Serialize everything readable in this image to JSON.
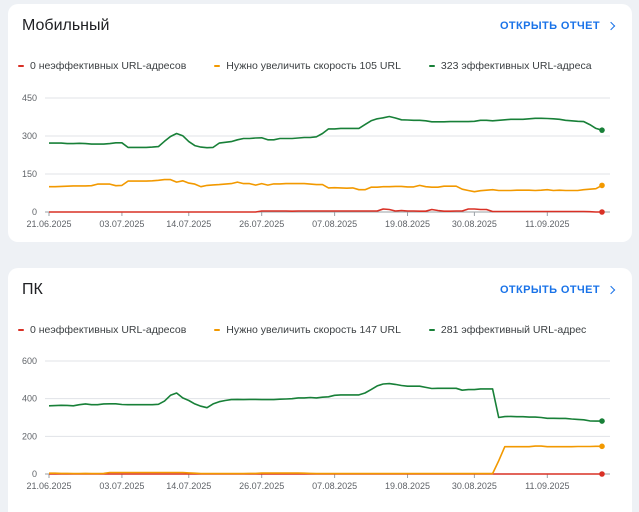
{
  "colors": {
    "error": "#d93025",
    "warning": "#f29900",
    "good": "#188038",
    "accent": "#1a73e8"
  },
  "chart_data": [
    {
      "type": "line",
      "title": "Мобильный",
      "action": "ОТКРЫТЬ ОТЧЕТ",
      "ylim": [
        0,
        450
      ],
      "yticks": [
        "0",
        "150",
        "300",
        "450"
      ],
      "xtick_labels": [
        "21.06.2025",
        "03.07.2025",
        "14.07.2025",
        "26.07.2025",
        "07.08.2025",
        "19.08.2025",
        "30.08.2025",
        "11.09.2025"
      ],
      "xtick_index": [
        0,
        12,
        23,
        35,
        47,
        59,
        70,
        82
      ],
      "legend": [
        "0 неэффективных URL-адресов",
        "Нужно увеличить скорость 105 URL",
        "323 эффективных URL-адреса"
      ],
      "series": [
        {
          "name": "0 неэффективных URL-адресов",
          "color": "#d93025",
          "values": [
            0,
            0,
            0,
            0,
            0,
            0,
            0,
            0,
            0,
            0,
            0,
            0,
            0,
            0,
            0,
            0,
            0,
            0,
            0,
            0,
            0,
            0,
            0,
            0,
            0,
            0,
            0,
            0,
            0,
            0,
            0,
            0,
            0,
            0,
            0,
            4,
            4,
            4,
            4,
            4,
            3,
            4,
            4,
            4,
            4,
            4,
            4,
            4,
            4,
            4,
            4,
            4,
            4,
            4,
            4,
            12,
            10,
            4,
            6,
            4,
            4,
            3,
            3,
            10,
            6,
            3,
            3,
            4,
            4,
            12,
            12,
            10,
            10,
            2,
            2,
            2,
            2,
            2,
            2,
            2,
            2,
            2,
            2,
            2,
            2,
            2,
            2,
            2,
            2,
            1,
            0,
            0
          ]
        },
        {
          "name": "Нужно увеличить скорость 105 URL",
          "color": "#f29900",
          "values": [
            100,
            100,
            101,
            102,
            103,
            103,
            103,
            104,
            110,
            110,
            110,
            104,
            105,
            122,
            122,
            122,
            122,
            123,
            125,
            128,
            128,
            118,
            123,
            114,
            110,
            100,
            105,
            107,
            108,
            110,
            112,
            118,
            112,
            112,
            106,
            112,
            106,
            111,
            111,
            112,
            112,
            112,
            112,
            110,
            108,
            108,
            95,
            96,
            95,
            94,
            95,
            88,
            88,
            98,
            98,
            100,
            100,
            101,
            101,
            99,
            99,
            105,
            100,
            98,
            98,
            102,
            102,
            102,
            90,
            85,
            80,
            84,
            86,
            88,
            85,
            85,
            85,
            86,
            86,
            86,
            85,
            86,
            88,
            85,
            86,
            85,
            85,
            85,
            88,
            90,
            92,
            105
          ]
        },
        {
          "name": "323 эффективных URL-адреса",
          "color": "#188038",
          "values": [
            272,
            272,
            272,
            270,
            270,
            271,
            270,
            268,
            268,
            268,
            270,
            273,
            273,
            255,
            255,
            255,
            255,
            256,
            258,
            279,
            298,
            310,
            301,
            278,
            262,
            256,
            254,
            255,
            272,
            275,
            278,
            285,
            290,
            290,
            292,
            293,
            285,
            285,
            290,
            290,
            290,
            292,
            294,
            294,
            297,
            310,
            328,
            328,
            330,
            330,
            330,
            330,
            345,
            360,
            368,
            372,
            377,
            371,
            364,
            363,
            362,
            362,
            360,
            356,
            356,
            356,
            357,
            357,
            357,
            357,
            358,
            362,
            362,
            360,
            362,
            364,
            366,
            366,
            366,
            368,
            370,
            370,
            369,
            368,
            366,
            362,
            360,
            358,
            357,
            345,
            330,
            323
          ]
        }
      ]
    },
    {
      "type": "line",
      "title": "ПК",
      "action": "ОТКРЫТЬ ОТЧЕТ",
      "ylim": [
        0,
        600
      ],
      "yticks": [
        "0",
        "200",
        "400",
        "600"
      ],
      "xtick_labels": [
        "21.06.2025",
        "03.07.2025",
        "14.07.2025",
        "26.07.2025",
        "07.08.2025",
        "19.08.2025",
        "30.08.2025",
        "11.09.2025"
      ],
      "xtick_index": [
        0,
        12,
        23,
        35,
        47,
        59,
        70,
        82
      ],
      "legend": [
        "0 неэффективных URL-адресов",
        "Нужно увеличить скорость 147 URL",
        "281 эффективный URL-адрес"
      ],
      "series": [
        {
          "name": "0 неэффективных URL-адресов",
          "color": "#d93025",
          "values": [
            0,
            0,
            0,
            0,
            0,
            0,
            0,
            0,
            0,
            0,
            0,
            0,
            0,
            0,
            0,
            0,
            0,
            0,
            0,
            0,
            0,
            0,
            0,
            0,
            0,
            0,
            0,
            0,
            0,
            0,
            0,
            0,
            0,
            0,
            0,
            0,
            0,
            0,
            0,
            0,
            0,
            0,
            0,
            0,
            0,
            0,
            0,
            0,
            0,
            0,
            0,
            0,
            0,
            0,
            0,
            0,
            0,
            0,
            0,
            0,
            0,
            0,
            0,
            0,
            0,
            0,
            0,
            0,
            0,
            0,
            0,
            0,
            0,
            0,
            0,
            0,
            0,
            0,
            0,
            0,
            0,
            0,
            0,
            0,
            0,
            0,
            0,
            0,
            0,
            0,
            0,
            0
          ]
        },
        {
          "name": "Нужно увеличить скорость 147 URL",
          "color": "#f29900",
          "values": [
            4,
            4,
            3,
            3,
            2,
            2,
            3,
            2,
            2,
            3,
            8,
            8,
            8,
            8,
            8,
            8,
            8,
            8,
            8,
            8,
            8,
            8,
            8,
            6,
            4,
            2,
            2,
            2,
            2,
            2,
            2,
            2,
            2,
            3,
            3,
            5,
            5,
            5,
            5,
            5,
            5,
            5,
            4,
            3,
            2,
            2,
            2,
            2,
            2,
            2,
            2,
            2,
            2,
            2,
            2,
            2,
            2,
            2,
            2,
            2,
            2,
            2,
            2,
            2,
            2,
            2,
            2,
            2,
            2,
            2,
            2,
            2,
            2,
            2,
            70,
            145,
            145,
            145,
            145,
            145,
            148,
            148,
            145,
            145,
            145,
            145,
            145,
            146,
            146,
            146,
            147,
            147
          ]
        },
        {
          "name": "281 эффективный URL-адрес",
          "color": "#188038",
          "values": [
            362,
            363,
            365,
            364,
            362,
            368,
            372,
            368,
            368,
            372,
            373,
            373,
            369,
            368,
            368,
            368,
            368,
            368,
            370,
            387,
            418,
            430,
            404,
            390,
            372,
            360,
            352,
            372,
            384,
            390,
            395,
            396,
            395,
            396,
            396,
            395,
            395,
            395,
            397,
            398,
            400,
            404,
            404,
            406,
            404,
            408,
            410,
            418,
            420,
            420,
            420,
            420,
            430,
            448,
            468,
            478,
            480,
            476,
            470,
            466,
            466,
            466,
            460,
            454,
            455,
            455,
            455,
            455,
            445,
            448,
            448,
            452,
            452,
            452,
            300,
            305,
            306,
            304,
            304,
            302,
            302,
            300,
            296,
            296,
            295,
            295,
            292,
            290,
            288,
            282,
            281,
            281
          ]
        }
      ]
    }
  ]
}
